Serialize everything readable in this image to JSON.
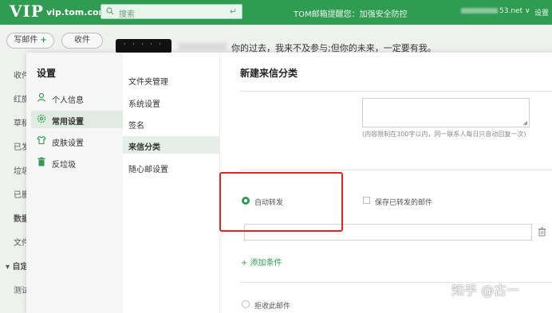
{
  "header": {
    "logo_vip": "VIP",
    "logo_domain": "vip.tom.com",
    "search_placeholder": "搜索",
    "notice": "TOM邮箱提醒您：加强安全防控",
    "account_suffix": "53.net ∨",
    "settings_link": "设置"
  },
  "mail": {
    "compose_label": "写邮件",
    "receive_label": "收件",
    "folders": [
      "收件",
      "红旗",
      "草稿",
      "已发",
      "垃圾",
      "已删",
      "数据",
      "文件",
      "▾ 自定",
      "测试"
    ],
    "quote": "你的过去，我来不及参与;但你的未来，一定要有我。"
  },
  "settings_menu": {
    "title": "设置",
    "items": [
      {
        "label": "个人信息",
        "icon": "user-icon"
      },
      {
        "label": "常用设置",
        "icon": "gear-icon"
      },
      {
        "label": "皮肤设置",
        "icon": "shirt-icon"
      },
      {
        "label": "反垃圾",
        "icon": "trash-bin-icon"
      }
    ],
    "active_index": 1
  },
  "sub_menu": {
    "items": [
      "文件夹管理",
      "系统设置",
      "签名",
      "来信分类",
      "随心邮设置"
    ],
    "active_index": 3
  },
  "content": {
    "title": "新建来信分类",
    "reply_hint": "(内容限制在300字以内，同一联系人每日只自动回复一次)",
    "auto_forward_label": "自动转发",
    "save_forwarded_label": "保存已转发的邮件",
    "add_condition_label": "+ 添加条件",
    "reject_label": "拒收此邮件"
  },
  "watermark": "知乎 @古一",
  "colors": {
    "brand_green": "#2f9c52",
    "highlight_red": "#e02424"
  }
}
